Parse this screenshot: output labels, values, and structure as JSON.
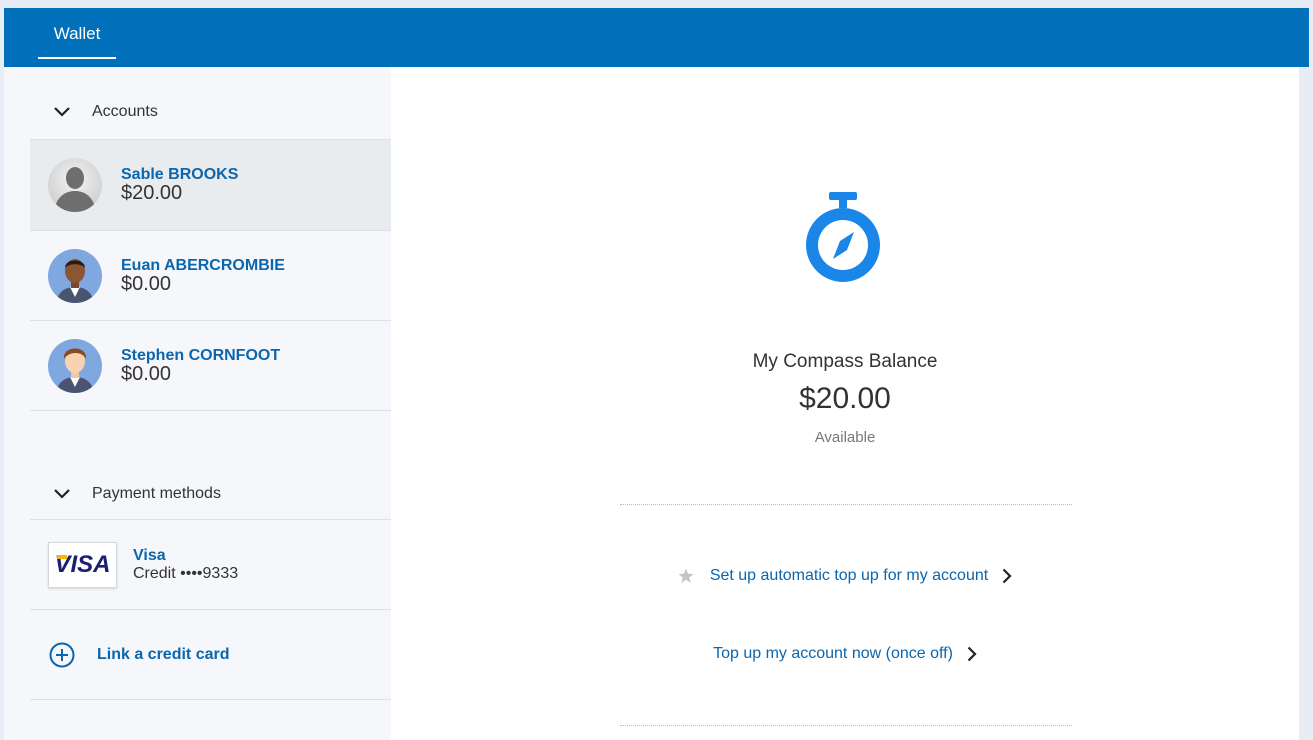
{
  "header": {
    "tab_label": "Wallet"
  },
  "sidebar": {
    "accounts_heading": "Accounts",
    "accounts": [
      {
        "name": "Sable BROOKS",
        "balance": "$20.00",
        "selected": true
      },
      {
        "name": "Euan ABERCROMBIE",
        "balance": "$0.00",
        "selected": false
      },
      {
        "name": "Stephen CORNFOOT",
        "balance": "$0.00",
        "selected": false
      }
    ],
    "payment_heading": "Payment methods",
    "card": {
      "brand_logo": "VISA",
      "name": "Visa",
      "description": "Credit ••••9333"
    },
    "link_card_label": "Link a credit card"
  },
  "main": {
    "balance_title": "My Compass Balance",
    "balance_amount": "$20.00",
    "balance_status": "Available",
    "auto_topup_label": "Set up automatic top up for my account",
    "topup_now_label": "Top up my account now (once off)"
  },
  "colors": {
    "brand_blue": "#0070bb",
    "link_blue": "#0b66ad",
    "icon_blue": "#1a87e8"
  }
}
